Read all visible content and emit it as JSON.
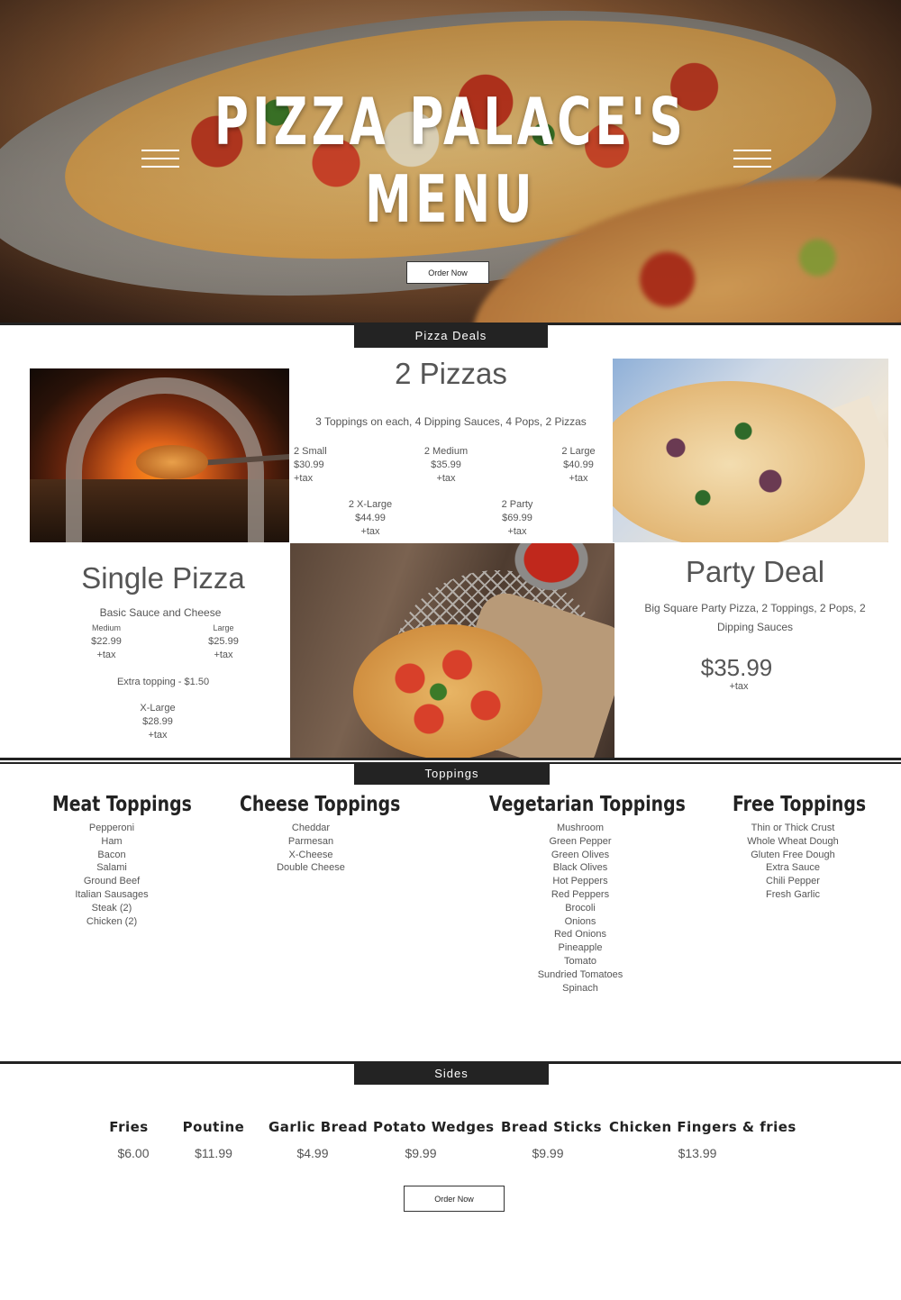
{
  "hero": {
    "title_line1": "PIZZA PALACE'S",
    "title_line2": "MENU",
    "order_button": "Order Now"
  },
  "pizza_deals": {
    "section_label": "Pizza Deals",
    "two_pizzas": {
      "title": "2 Pizzas",
      "description": "3 Toppings on each, 4 Dipping Sauces, 4 Pops, 2 Pizzas",
      "options": [
        {
          "size": "2 Small",
          "price": "$30.99",
          "tax": "+tax"
        },
        {
          "size": "2 Medium",
          "price": "$35.99",
          "tax": "+tax"
        },
        {
          "size": "2 Large",
          "price": "$40.99",
          "tax": "+tax"
        },
        {
          "size": "2 X-Large",
          "price": "$44.99",
          "tax": "+tax"
        },
        {
          "size": "2 Party",
          "price": "$69.99",
          "tax": "+tax"
        }
      ]
    },
    "single_pizza": {
      "title": "Single Pizza",
      "description": "Basic Sauce and Cheese",
      "options": [
        {
          "size": "Medium",
          "price": "$22.99",
          "tax": "+tax"
        },
        {
          "size": "Large",
          "price": "$25.99",
          "tax": "+tax"
        },
        {
          "size": "X-Large",
          "price": "$28.99",
          "tax": "+tax"
        }
      ],
      "extra_topping": "Extra topping - $1.50"
    },
    "party_deal": {
      "title": "Party Deal",
      "description_line1": "Big Square Party Pizza, 2 Toppings, 2 Pops, 2",
      "description_line2": "Dipping Sauces",
      "price": "$35.99",
      "tax": "+tax"
    }
  },
  "toppings": {
    "section_label": "Toppings",
    "meat": {
      "heading": "Meat Toppings",
      "items": [
        "Pepperoni",
        "Ham",
        "Bacon",
        "Salami",
        "Ground Beef",
        "Italian Sausages",
        "Steak (2)",
        "Chicken (2)"
      ]
    },
    "cheese": {
      "heading": "Cheese Toppings",
      "items": [
        "Cheddar",
        "Parmesan",
        "X-Cheese",
        "Double Cheese"
      ]
    },
    "vegetarian": {
      "heading": "Vegetarian Toppings",
      "items": [
        "Mushroom",
        "Green Pepper",
        "Green Olives",
        "Black Olives",
        "Hot Peppers",
        "Red Peppers",
        "Brocoli",
        "Onions",
        "Red Onions",
        "Pineapple",
        "Tomato",
        "Sundried Tomatoes",
        "Spinach"
      ]
    },
    "free": {
      "heading": "Free Toppings",
      "items": [
        "Thin or Thick Crust",
        "Whole Wheat Dough",
        "Gluten Free Dough",
        "Extra Sauce",
        "Chili Pepper",
        "Fresh Garlic"
      ]
    }
  },
  "sides": {
    "section_label": "Sides",
    "items": [
      {
        "name": "Fries",
        "price": "$6.00"
      },
      {
        "name": "Poutine",
        "price": "$11.99"
      },
      {
        "name": "Garlic Bread",
        "price": "$4.99"
      },
      {
        "name": "Potato Wedges",
        "price": "$9.99"
      },
      {
        "name": "Bread Sticks",
        "price": "$9.99"
      },
      {
        "name": "Chicken Fingers & fries",
        "price": "$13.99"
      }
    ],
    "order_button": "Order Now"
  }
}
